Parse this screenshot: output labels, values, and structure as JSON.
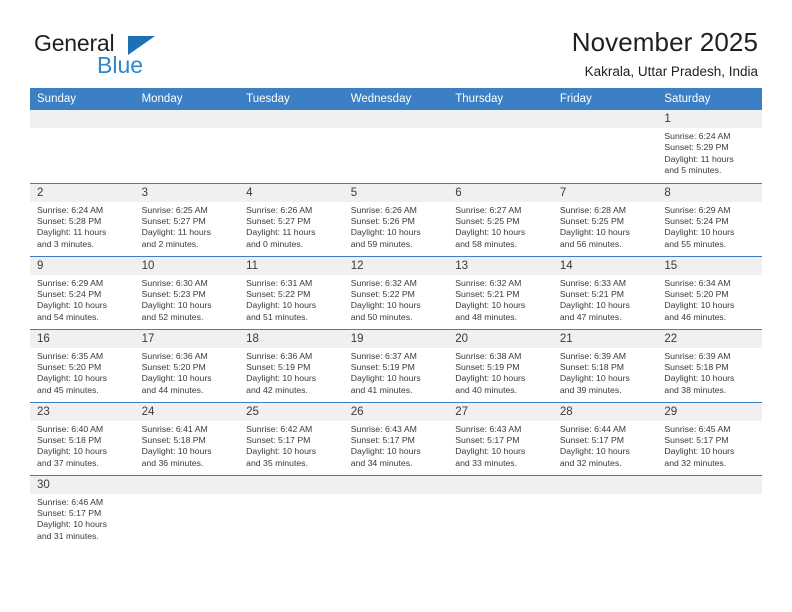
{
  "logo": {
    "word1": "General",
    "word2": "Blue",
    "triangle_color": "#1f6fb5",
    "blue_color": "#2d87c8"
  },
  "header": {
    "title": "November 2025",
    "subtitle": "Kakrala, Uttar Pradesh, India"
  },
  "theme": {
    "header_blue": "#3b7fc4",
    "daynum_band": "#f0f0f0",
    "text": "#3a3a3a"
  },
  "weekdays": [
    "Sunday",
    "Monday",
    "Tuesday",
    "Wednesday",
    "Thursday",
    "Friday",
    "Saturday"
  ],
  "weeks": [
    [
      {
        "day": "",
        "sunrise": "",
        "sunset": "",
        "daylight1": "",
        "daylight2": ""
      },
      {
        "day": "",
        "sunrise": "",
        "sunset": "",
        "daylight1": "",
        "daylight2": ""
      },
      {
        "day": "",
        "sunrise": "",
        "sunset": "",
        "daylight1": "",
        "daylight2": ""
      },
      {
        "day": "",
        "sunrise": "",
        "sunset": "",
        "daylight1": "",
        "daylight2": ""
      },
      {
        "day": "",
        "sunrise": "",
        "sunset": "",
        "daylight1": "",
        "daylight2": ""
      },
      {
        "day": "",
        "sunrise": "",
        "sunset": "",
        "daylight1": "",
        "daylight2": ""
      },
      {
        "day": "1",
        "sunrise": "Sunrise: 6:24 AM",
        "sunset": "Sunset: 5:29 PM",
        "daylight1": "Daylight: 11 hours",
        "daylight2": "and 5 minutes."
      }
    ],
    [
      {
        "day": "2",
        "sunrise": "Sunrise: 6:24 AM",
        "sunset": "Sunset: 5:28 PM",
        "daylight1": "Daylight: 11 hours",
        "daylight2": "and 3 minutes."
      },
      {
        "day": "3",
        "sunrise": "Sunrise: 6:25 AM",
        "sunset": "Sunset: 5:27 PM",
        "daylight1": "Daylight: 11 hours",
        "daylight2": "and 2 minutes."
      },
      {
        "day": "4",
        "sunrise": "Sunrise: 6:26 AM",
        "sunset": "Sunset: 5:27 PM",
        "daylight1": "Daylight: 11 hours",
        "daylight2": "and 0 minutes."
      },
      {
        "day": "5",
        "sunrise": "Sunrise: 6:26 AM",
        "sunset": "Sunset: 5:26 PM",
        "daylight1": "Daylight: 10 hours",
        "daylight2": "and 59 minutes."
      },
      {
        "day": "6",
        "sunrise": "Sunrise: 6:27 AM",
        "sunset": "Sunset: 5:25 PM",
        "daylight1": "Daylight: 10 hours",
        "daylight2": "and 58 minutes."
      },
      {
        "day": "7",
        "sunrise": "Sunrise: 6:28 AM",
        "sunset": "Sunset: 5:25 PM",
        "daylight1": "Daylight: 10 hours",
        "daylight2": "and 56 minutes."
      },
      {
        "day": "8",
        "sunrise": "Sunrise: 6:29 AM",
        "sunset": "Sunset: 5:24 PM",
        "daylight1": "Daylight: 10 hours",
        "daylight2": "and 55 minutes."
      }
    ],
    [
      {
        "day": "9",
        "sunrise": "Sunrise: 6:29 AM",
        "sunset": "Sunset: 5:24 PM",
        "daylight1": "Daylight: 10 hours",
        "daylight2": "and 54 minutes."
      },
      {
        "day": "10",
        "sunrise": "Sunrise: 6:30 AM",
        "sunset": "Sunset: 5:23 PM",
        "daylight1": "Daylight: 10 hours",
        "daylight2": "and 52 minutes."
      },
      {
        "day": "11",
        "sunrise": "Sunrise: 6:31 AM",
        "sunset": "Sunset: 5:22 PM",
        "daylight1": "Daylight: 10 hours",
        "daylight2": "and 51 minutes."
      },
      {
        "day": "12",
        "sunrise": "Sunrise: 6:32 AM",
        "sunset": "Sunset: 5:22 PM",
        "daylight1": "Daylight: 10 hours",
        "daylight2": "and 50 minutes."
      },
      {
        "day": "13",
        "sunrise": "Sunrise: 6:32 AM",
        "sunset": "Sunset: 5:21 PM",
        "daylight1": "Daylight: 10 hours",
        "daylight2": "and 48 minutes."
      },
      {
        "day": "14",
        "sunrise": "Sunrise: 6:33 AM",
        "sunset": "Sunset: 5:21 PM",
        "daylight1": "Daylight: 10 hours",
        "daylight2": "and 47 minutes."
      },
      {
        "day": "15",
        "sunrise": "Sunrise: 6:34 AM",
        "sunset": "Sunset: 5:20 PM",
        "daylight1": "Daylight: 10 hours",
        "daylight2": "and 46 minutes."
      }
    ],
    [
      {
        "day": "16",
        "sunrise": "Sunrise: 6:35 AM",
        "sunset": "Sunset: 5:20 PM",
        "daylight1": "Daylight: 10 hours",
        "daylight2": "and 45 minutes."
      },
      {
        "day": "17",
        "sunrise": "Sunrise: 6:36 AM",
        "sunset": "Sunset: 5:20 PM",
        "daylight1": "Daylight: 10 hours",
        "daylight2": "and 44 minutes."
      },
      {
        "day": "18",
        "sunrise": "Sunrise: 6:36 AM",
        "sunset": "Sunset: 5:19 PM",
        "daylight1": "Daylight: 10 hours",
        "daylight2": "and 42 minutes."
      },
      {
        "day": "19",
        "sunrise": "Sunrise: 6:37 AM",
        "sunset": "Sunset: 5:19 PM",
        "daylight1": "Daylight: 10 hours",
        "daylight2": "and 41 minutes."
      },
      {
        "day": "20",
        "sunrise": "Sunrise: 6:38 AM",
        "sunset": "Sunset: 5:19 PM",
        "daylight1": "Daylight: 10 hours",
        "daylight2": "and 40 minutes."
      },
      {
        "day": "21",
        "sunrise": "Sunrise: 6:39 AM",
        "sunset": "Sunset: 5:18 PM",
        "daylight1": "Daylight: 10 hours",
        "daylight2": "and 39 minutes."
      },
      {
        "day": "22",
        "sunrise": "Sunrise: 6:39 AM",
        "sunset": "Sunset: 5:18 PM",
        "daylight1": "Daylight: 10 hours",
        "daylight2": "and 38 minutes."
      }
    ],
    [
      {
        "day": "23",
        "sunrise": "Sunrise: 6:40 AM",
        "sunset": "Sunset: 5:18 PM",
        "daylight1": "Daylight: 10 hours",
        "daylight2": "and 37 minutes."
      },
      {
        "day": "24",
        "sunrise": "Sunrise: 6:41 AM",
        "sunset": "Sunset: 5:18 PM",
        "daylight1": "Daylight: 10 hours",
        "daylight2": "and 36 minutes."
      },
      {
        "day": "25",
        "sunrise": "Sunrise: 6:42 AM",
        "sunset": "Sunset: 5:17 PM",
        "daylight1": "Daylight: 10 hours",
        "daylight2": "and 35 minutes."
      },
      {
        "day": "26",
        "sunrise": "Sunrise: 6:43 AM",
        "sunset": "Sunset: 5:17 PM",
        "daylight1": "Daylight: 10 hours",
        "daylight2": "and 34 minutes."
      },
      {
        "day": "27",
        "sunrise": "Sunrise: 6:43 AM",
        "sunset": "Sunset: 5:17 PM",
        "daylight1": "Daylight: 10 hours",
        "daylight2": "and 33 minutes."
      },
      {
        "day": "28",
        "sunrise": "Sunrise: 6:44 AM",
        "sunset": "Sunset: 5:17 PM",
        "daylight1": "Daylight: 10 hours",
        "daylight2": "and 32 minutes."
      },
      {
        "day": "29",
        "sunrise": "Sunrise: 6:45 AM",
        "sunset": "Sunset: 5:17 PM",
        "daylight1": "Daylight: 10 hours",
        "daylight2": "and 32 minutes."
      }
    ],
    [
      {
        "day": "30",
        "sunrise": "Sunrise: 6:46 AM",
        "sunset": "Sunset: 5:17 PM",
        "daylight1": "Daylight: 10 hours",
        "daylight2": "and 31 minutes."
      },
      {
        "day": "",
        "sunrise": "",
        "sunset": "",
        "daylight1": "",
        "daylight2": ""
      },
      {
        "day": "",
        "sunrise": "",
        "sunset": "",
        "daylight1": "",
        "daylight2": ""
      },
      {
        "day": "",
        "sunrise": "",
        "sunset": "",
        "daylight1": "",
        "daylight2": ""
      },
      {
        "day": "",
        "sunrise": "",
        "sunset": "",
        "daylight1": "",
        "daylight2": ""
      },
      {
        "day": "",
        "sunrise": "",
        "sunset": "",
        "daylight1": "",
        "daylight2": ""
      },
      {
        "day": "",
        "sunrise": "",
        "sunset": "",
        "daylight1": "",
        "daylight2": ""
      }
    ]
  ]
}
